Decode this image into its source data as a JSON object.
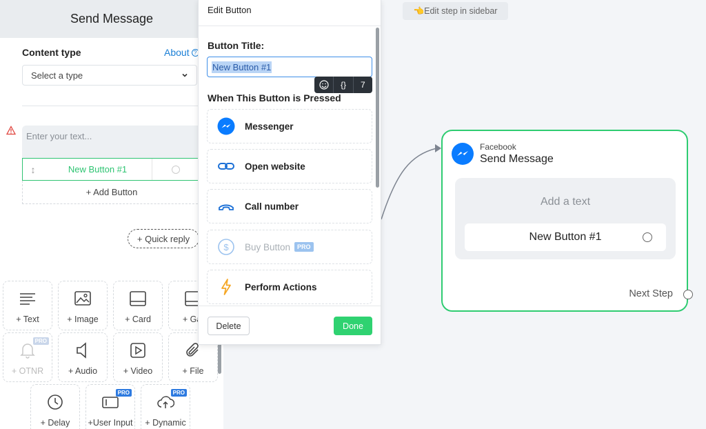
{
  "sidebar": {
    "header_title": "Send Message",
    "content_type_label": "Content type",
    "about_link": "About",
    "select_placeholder": "Select a type",
    "text_placeholder": "Enter your text...",
    "button_label": "New Button #1",
    "add_button": "+ Add Button",
    "quick_reply": "+ Quick reply",
    "tiles": [
      {
        "label": "+ Text",
        "icon": "text-lines-icon"
      },
      {
        "label": "+ Image",
        "icon": "image-icon"
      },
      {
        "label": "+ Card",
        "icon": "card-icon"
      },
      {
        "label": "+ Gal",
        "icon": "gallery-icon"
      },
      {
        "label": "+ OTNR",
        "icon": "bell-icon",
        "pro": "PRO"
      },
      {
        "label": "+ Audio",
        "icon": "speaker-icon"
      },
      {
        "label": "+ Video",
        "icon": "video-icon"
      },
      {
        "label": "+ File",
        "icon": "paperclip-icon"
      },
      {
        "label": "+ Delay",
        "icon": "clock-icon"
      },
      {
        "label": "+User Input",
        "icon": "user-input-icon",
        "pro": "PRO"
      },
      {
        "label": "+ Dynamic",
        "icon": "cloud-upload-icon",
        "pro": "PRO"
      }
    ]
  },
  "panel": {
    "title": "Edit Button",
    "button_title_label": "Button Title:",
    "button_title_value": "New Button #1",
    "tools": {
      "count": "7",
      "braces": "{}"
    },
    "when_label": "When This Button is Pressed",
    "options": [
      {
        "label": "Messenger",
        "icon": "messenger-icon"
      },
      {
        "label": "Open website",
        "icon": "link-icon"
      },
      {
        "label": "Call number",
        "icon": "phone-icon"
      },
      {
        "label": "Buy Button",
        "icon": "dollar-icon",
        "badge": "PRO"
      },
      {
        "label": "Perform Actions",
        "icon": "lightning-icon"
      }
    ],
    "delete": "Delete",
    "done": "Done"
  },
  "canvas": {
    "hint": "👈Edit step in sidebar",
    "node": {
      "platform": "Facebook",
      "title": "Send Message",
      "add_text": "Add a text",
      "button_label": "New Button #1",
      "next_step": "Next Step"
    }
  },
  "colors": {
    "accent_green": "#2ecc71",
    "link_blue": "#1a7fd6",
    "messenger_blue": "#0a7cff",
    "pro_blue": "#2d7ae0"
  }
}
